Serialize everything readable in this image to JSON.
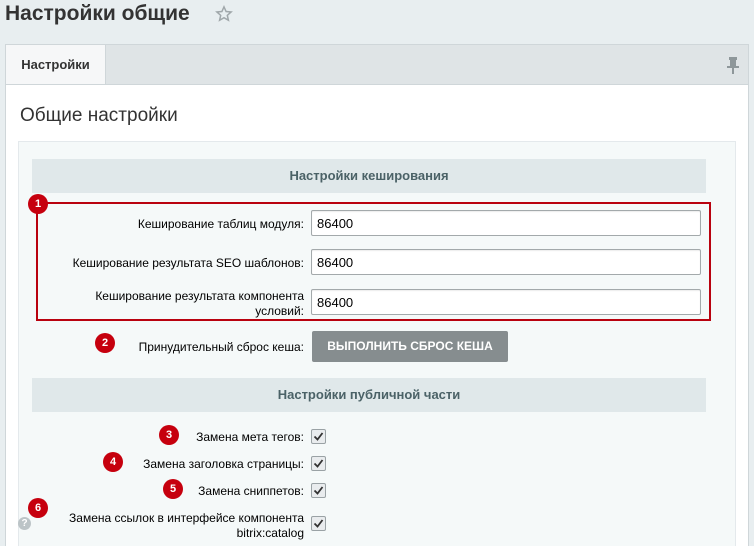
{
  "header": {
    "title": "Настройки общие"
  },
  "tabs": [
    {
      "label": "Настройки"
    }
  ],
  "main": {
    "section_title": "Общие настройки",
    "cache_group": {
      "title": "Настройки кеширования",
      "fields": [
        {
          "badge": "1",
          "label": "Кеширование таблиц модуля:",
          "value": "86400"
        },
        {
          "label": "Кеширование результата SEO шаблонов:",
          "value": "86400"
        },
        {
          "label_line1": "Кеширование результата компонента",
          "label_line2": "условий:",
          "value": "86400"
        }
      ],
      "reset": {
        "badge": "2",
        "label": "Принудительный сброс кеша:",
        "button": "ВЫПОЛНИТЬ СБРОС КЕША"
      }
    },
    "public_group": {
      "title": "Настройки публичной части",
      "options": [
        {
          "badge": "3",
          "label": "Замена мета тегов:",
          "checked": true
        },
        {
          "badge": "4",
          "label": "Замена заголовка страницы:",
          "checked": true
        },
        {
          "badge": "5",
          "label": "Замена сниппетов:",
          "checked": true
        },
        {
          "badge": "6",
          "label_line1": "Замена ссылок в интерфейсе компонента",
          "label_line2": "bitrix:catalog",
          "checked": true
        }
      ],
      "help": "?"
    }
  },
  "colors": {
    "badge": "#c6000e",
    "highlight_border": "#b9020f",
    "button": "#868d8f"
  }
}
